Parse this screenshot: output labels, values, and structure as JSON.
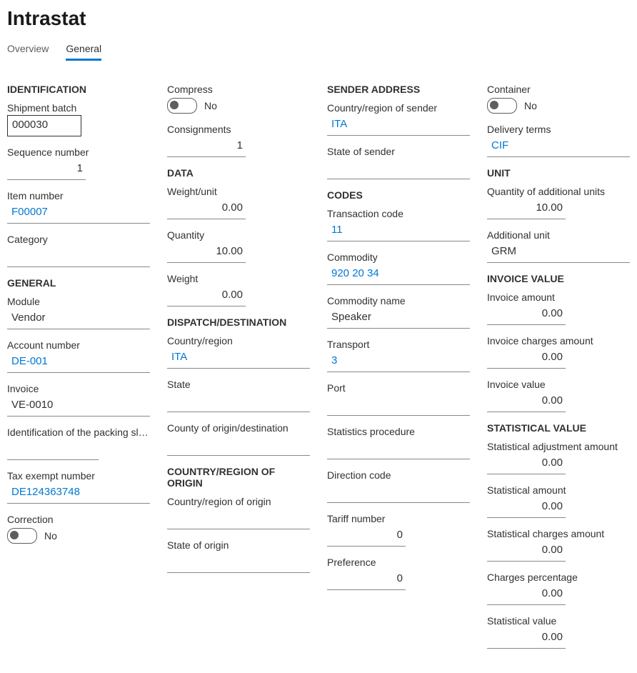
{
  "pageTitle": "Intrastat",
  "tabs": {
    "overview": "Overview",
    "general": "General"
  },
  "identification": {
    "heading": "IDENTIFICATION",
    "shipmentBatch": {
      "label": "Shipment batch",
      "value": "000030"
    },
    "sequenceNumber": {
      "label": "Sequence number",
      "value": "1"
    },
    "itemNumber": {
      "label": "Item number",
      "value": "F00007"
    },
    "category": {
      "label": "Category",
      "value": ""
    }
  },
  "general": {
    "heading": "GENERAL",
    "module": {
      "label": "Module",
      "value": "Vendor"
    },
    "accountNumber": {
      "label": "Account number",
      "value": "DE-001"
    },
    "invoice": {
      "label": "Invoice",
      "value": "VE-0010"
    },
    "packingSlip": {
      "label": "Identification of the packing slip ...",
      "value": ""
    },
    "taxExempt": {
      "label": "Tax exempt number",
      "value": "DE124363748"
    },
    "correction": {
      "label": "Correction",
      "value": "No"
    }
  },
  "compress": {
    "label": "Compress",
    "value": "No"
  },
  "consignments": {
    "label": "Consignments",
    "value": "1"
  },
  "data": {
    "heading": "DATA",
    "weightUnit": {
      "label": "Weight/unit",
      "value": "0.00"
    },
    "quantity": {
      "label": "Quantity",
      "value": "10.00"
    },
    "weight": {
      "label": "Weight",
      "value": "0.00"
    }
  },
  "dispatch": {
    "heading": "DISPATCH/DESTINATION",
    "countryRegion": {
      "label": "Country/region",
      "value": "ITA"
    },
    "state": {
      "label": "State",
      "value": ""
    },
    "countyOrigin": {
      "label": "County of origin/destination",
      "value": ""
    }
  },
  "countryOrigin": {
    "heading": "COUNTRY/REGION OF ORIGIN",
    "country": {
      "label": "Country/region of origin",
      "value": ""
    },
    "state": {
      "label": "State of origin",
      "value": ""
    }
  },
  "senderAddress": {
    "heading": "SENDER ADDRESS",
    "country": {
      "label": "Country/region of sender",
      "value": "ITA"
    },
    "state": {
      "label": "State of sender",
      "value": ""
    }
  },
  "codes": {
    "heading": "CODES",
    "transactionCode": {
      "label": "Transaction code",
      "value": "11"
    },
    "commodity": {
      "label": "Commodity",
      "value": "920 20 34"
    },
    "commodityName": {
      "label": "Commodity name",
      "value": "Speaker"
    },
    "transport": {
      "label": "Transport",
      "value": "3"
    },
    "port": {
      "label": "Port",
      "value": ""
    },
    "statisticsProcedure": {
      "label": "Statistics procedure",
      "value": ""
    },
    "directionCode": {
      "label": "Direction code",
      "value": ""
    },
    "tariffNumber": {
      "label": "Tariff number",
      "value": "0"
    },
    "preference": {
      "label": "Preference",
      "value": "0"
    }
  },
  "container": {
    "label": "Container",
    "value": "No"
  },
  "deliveryTerms": {
    "label": "Delivery terms",
    "value": "CIF"
  },
  "unit": {
    "heading": "UNIT",
    "qtyAdditional": {
      "label": "Quantity of additional units",
      "value": "10.00"
    },
    "additionalUnit": {
      "label": "Additional unit",
      "value": "GRM"
    }
  },
  "invoiceValue": {
    "heading": "INVOICE VALUE",
    "invoiceAmount": {
      "label": "Invoice amount",
      "value": "0.00"
    },
    "invoiceCharges": {
      "label": "Invoice charges amount",
      "value": "0.00"
    },
    "invoiceValue": {
      "label": "Invoice value",
      "value": "0.00"
    }
  },
  "statisticalValue": {
    "heading": "STATISTICAL VALUE",
    "adjustment": {
      "label": "Statistical adjustment amount",
      "value": "0.00"
    },
    "amount": {
      "label": "Statistical amount",
      "value": "0.00"
    },
    "charges": {
      "label": "Statistical charges amount",
      "value": "0.00"
    },
    "percentage": {
      "label": "Charges percentage",
      "value": "0.00"
    },
    "value": {
      "label": "Statistical value",
      "value": "0.00"
    }
  }
}
